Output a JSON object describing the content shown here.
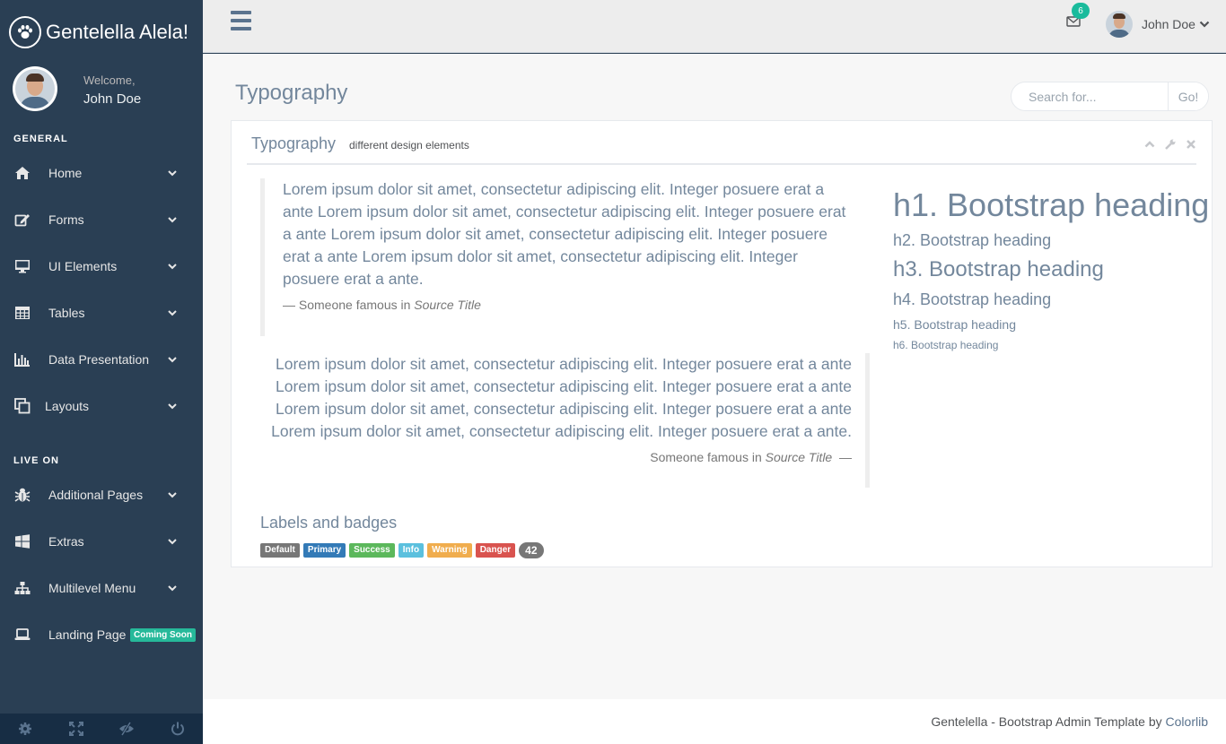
{
  "brand": {
    "title": "Gentelella Alela!",
    "icon": "paw-icon"
  },
  "profile": {
    "welcome": "Welcome,",
    "name": "John Doe"
  },
  "sidebar": {
    "sections": [
      {
        "title": "GENERAL",
        "items": [
          {
            "label": "Home",
            "icon": "home-icon"
          },
          {
            "label": "Forms",
            "icon": "edit-icon"
          },
          {
            "label": "UI Elements",
            "icon": "desktop-icon"
          },
          {
            "label": "Tables",
            "icon": "table-icon"
          },
          {
            "label": "Data Presentation",
            "icon": "bar-chart-icon"
          },
          {
            "label": "Layouts",
            "icon": "clone-icon"
          }
        ]
      },
      {
        "title": "LIVE ON",
        "items": [
          {
            "label": "Additional Pages",
            "icon": "bug-icon"
          },
          {
            "label": "Extras",
            "icon": "windows-icon"
          },
          {
            "label": "Multilevel Menu",
            "icon": "sitemap-icon"
          },
          {
            "label": "Landing Page",
            "icon": "laptop-icon",
            "badge": "Coming Soon"
          }
        ]
      }
    ],
    "footer_icons": [
      "settings-icon",
      "fullscreen-icon",
      "eye-slash-icon",
      "power-icon"
    ]
  },
  "topnav": {
    "notification_count": "6",
    "user_name": "John Doe"
  },
  "page": {
    "title": "Typography"
  },
  "search": {
    "placeholder": "Search for...",
    "button": "Go!"
  },
  "panel": {
    "title": "Typography",
    "subtitle": "different design elements",
    "blockquote_left": {
      "text": "Lorem ipsum dolor sit amet, consectetur adipiscing elit. Integer posuere erat a ante Lorem ipsum dolor sit amet, consectetur adipiscing elit. Integer posuere erat a ante Lorem ipsum dolor sit amet, consectetur adipiscing elit. Integer posuere erat a ante Lorem ipsum dolor sit amet, consectetur adipiscing elit. Integer posuere erat a ante.",
      "footer_prefix": "— Someone famous in ",
      "footer_source": "Source Title"
    },
    "blockquote_right": {
      "text": "Lorem ipsum dolor sit amet, consectetur adipiscing elit. Integer posuere erat a ante Lorem ipsum dolor sit amet, consectetur adipiscing elit. Integer posuere erat a ante Lorem ipsum dolor sit amet, consectetur adipiscing elit. Integer posuere erat a ante Lorem ipsum dolor sit amet, consectetur adipiscing elit. Integer posuere erat a ante.",
      "footer_prefix": "Someone famous in ",
      "footer_source": "Source Title",
      "footer_suffix": "  —"
    },
    "headings": {
      "h1": "h1. Bootstrap heading",
      "h2": "h2. Bootstrap heading",
      "h3": "h3. Bootstrap heading",
      "h4": "h4. Bootstrap heading",
      "h5": "h5. Bootstrap heading",
      "h6": "h6. Bootstrap heading"
    },
    "labels_title": "Labels and badges",
    "labels": [
      {
        "text": "Default",
        "color": "#777777"
      },
      {
        "text": "Primary",
        "color": "#337AB7"
      },
      {
        "text": "Success",
        "color": "#5CB85C"
      },
      {
        "text": "Info",
        "color": "#5BC0DE"
      },
      {
        "text": "Warning",
        "color": "#F0AD4E"
      },
      {
        "text": "Danger",
        "color": "#D9534F"
      }
    ],
    "badge": "42"
  },
  "footer": {
    "text": "Gentelella - Bootstrap Admin Template by ",
    "link": "Colorlib"
  }
}
